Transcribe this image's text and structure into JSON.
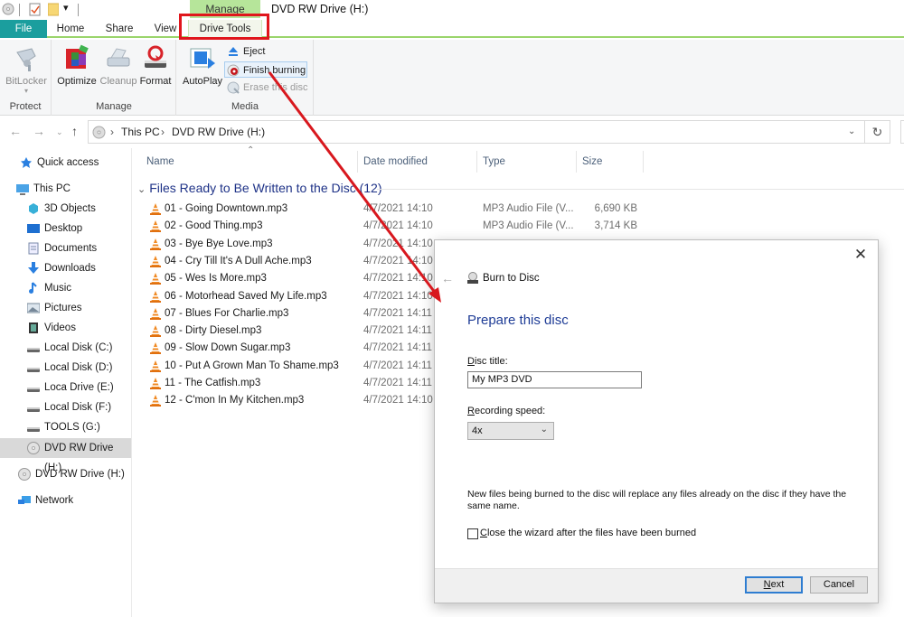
{
  "titlebar": {
    "manage_tab": "Manage",
    "window_title": "DVD RW Drive (H:)"
  },
  "tabs": [
    {
      "label": "File"
    },
    {
      "label": "Home"
    },
    {
      "label": "Share"
    },
    {
      "label": "View"
    },
    {
      "label": "Drive Tools",
      "active": true
    }
  ],
  "ribbon": {
    "groups": [
      {
        "label": "Protect",
        "buttons": [
          {
            "label": "BitLocker",
            "disabled": true
          }
        ]
      },
      {
        "label": "Manage",
        "buttons": [
          {
            "label": "Optimize"
          },
          {
            "label": "Cleanup",
            "disabled": true
          },
          {
            "label": "Format"
          }
        ]
      },
      {
        "label": "Media",
        "buttons": [
          {
            "label": "AutoPlay"
          }
        ],
        "small_buttons": [
          {
            "label": "Eject"
          },
          {
            "label": "Finish burning",
            "highlighted": true
          },
          {
            "label": "Erase this disc",
            "disabled": true
          }
        ]
      }
    ]
  },
  "navigation": {
    "breadcrumb": [
      "This PC",
      "DVD RW Drive (H:)"
    ]
  },
  "sidebar": {
    "items": [
      {
        "label": "Quick access",
        "icon": "star-icon"
      },
      {
        "label": "This PC",
        "icon": "computer-icon"
      },
      {
        "label": "3D Objects",
        "icon": "cube-icon"
      },
      {
        "label": "Desktop",
        "icon": "desktop-icon"
      },
      {
        "label": "Documents",
        "icon": "document-icon"
      },
      {
        "label": "Downloads",
        "icon": "download-icon"
      },
      {
        "label": "Music",
        "icon": "music-icon"
      },
      {
        "label": "Pictures",
        "icon": "picture-icon"
      },
      {
        "label": "Videos",
        "icon": "video-icon"
      },
      {
        "label": "Local Disk (C:)",
        "icon": "drive-icon"
      },
      {
        "label": "Local Disk (D:)",
        "icon": "drive-icon"
      },
      {
        "label": "Loca Drive (E:)",
        "icon": "drive-icon"
      },
      {
        "label": "Local Disk (F:)",
        "icon": "drive-icon"
      },
      {
        "label": "TOOLS (G:)",
        "icon": "drive-icon"
      },
      {
        "label": "DVD RW Drive (H:)",
        "icon": "disc-icon",
        "selected": true
      },
      {
        "label": "DVD RW Drive (H:)",
        "icon": "disc-icon"
      },
      {
        "label": "Network",
        "icon": "network-icon"
      }
    ]
  },
  "filelist": {
    "columns": [
      "Name",
      "Date modified",
      "Type",
      "Size"
    ],
    "group_header": "Files Ready to Be Written to the Disc (12)",
    "rows": [
      {
        "name": "01 - Going Downtown.mp3",
        "date": "4/7/2021 14:10",
        "type": "MP3 Audio File (V...",
        "size": "6,690 KB"
      },
      {
        "name": "02 - Good Thing.mp3",
        "date": "4/7/2021 14:10",
        "type": "MP3 Audio File (V...",
        "size": "3,714 KB"
      },
      {
        "name": "03 - Bye Bye Love.mp3",
        "date": "4/7/2021 14:10",
        "type": "",
        "size": ""
      },
      {
        "name": "04 - Cry Till It's A Dull Ache.mp3",
        "date": "4/7/2021 14:10",
        "type": "",
        "size": ""
      },
      {
        "name": "05 - Wes Is More.mp3",
        "date": "4/7/2021 14:10",
        "type": "",
        "size": ""
      },
      {
        "name": "06 - Motorhead Saved My Life.mp3",
        "date": "4/7/2021 14:10",
        "type": "",
        "size": ""
      },
      {
        "name": "07 - Blues For Charlie.mp3",
        "date": "4/7/2021 14:11",
        "type": "",
        "size": ""
      },
      {
        "name": "08 - Dirty Diesel.mp3",
        "date": "4/7/2021 14:11",
        "type": "",
        "size": ""
      },
      {
        "name": "09 - Slow Down Sugar.mp3",
        "date": "4/7/2021 14:11",
        "type": "",
        "size": ""
      },
      {
        "name": "10 - Put A Grown Man To Shame.mp3",
        "date": "4/7/2021 14:11",
        "type": "",
        "size": ""
      },
      {
        "name": "11 - The Catfish.mp3",
        "date": "4/7/2021 14:11",
        "type": "",
        "size": ""
      },
      {
        "name": "12 - C'mon In My Kitchen.mp3",
        "date": "4/7/2021 14:10",
        "type": "",
        "size": ""
      }
    ]
  },
  "dialog": {
    "title": "Burn to Disc",
    "heading": "Prepare this disc",
    "disc_title_label": "Disc title:",
    "disc_title_value": "My MP3 DVD",
    "recording_speed_label": "Recording speed:",
    "recording_speed_value": "4x",
    "note": "New files being burned to the disc will replace any files already on the disc if they have the same name.",
    "close_wizard_label": "Close the wizard after the files have been burned",
    "close_wizard_checked": false,
    "next_label": "Next",
    "cancel_label": "Cancel"
  },
  "annotation": {
    "highlight_color": "#e0161c"
  }
}
